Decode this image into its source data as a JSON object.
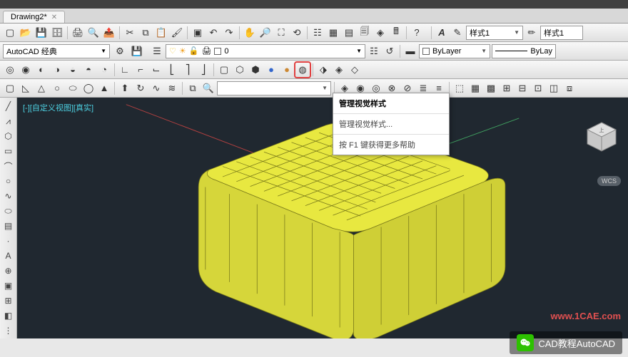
{
  "tab": {
    "title": "Drawing2*"
  },
  "workspace": {
    "label": "AutoCAD 经典"
  },
  "layer": {
    "current": "0"
  },
  "style1": {
    "label": "样式1"
  },
  "style1b": {
    "label": "样式1"
  },
  "bylayer": {
    "label": "ByLayer"
  },
  "bylayer2": {
    "label": "ByLay"
  },
  "viewport": {
    "label": "[-][自定义视图][真实]"
  },
  "tooltip": {
    "title": "管理视觉样式",
    "desc": "管理视觉样式...",
    "help": "按 F1 键获得更多帮助"
  },
  "wcs": {
    "label": "WCS"
  },
  "watermark": {
    "text": ".COM"
  },
  "url": {
    "text": "www.1CAE.com"
  },
  "footer": {
    "text": "CAD教程AutoCAD"
  }
}
